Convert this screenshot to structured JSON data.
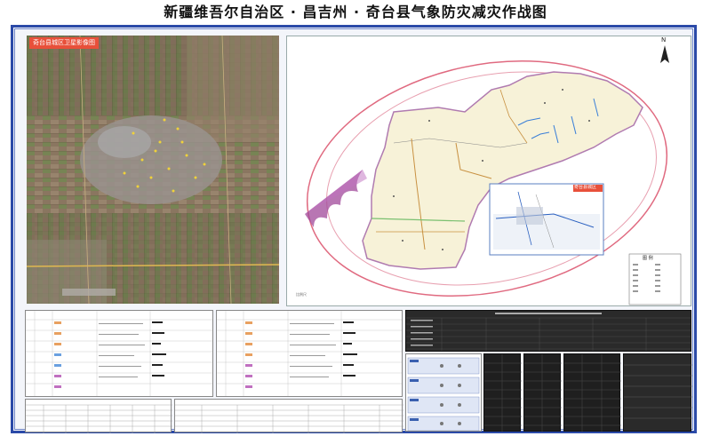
{
  "page": {
    "title": "新疆维吾尔自治区 · 昌吉州 · 奇台县气象防灾减灾作战图"
  },
  "satellite": {
    "label": "奇台县城区卫星影像图"
  },
  "map": {
    "north_label": "N",
    "inset_label": "奇台县城区",
    "legend_title": "图 例",
    "scale_text": "比例尺",
    "colors": {
      "county_fill": "#f7f2d8",
      "county_border": "#b07bb0",
      "ring_outer": "#e06a80",
      "ring_inner": "#e8a0b0",
      "fan": "#a0489a",
      "road": "#c89040",
      "river": "#3a7fd8",
      "highway": "#7ac070"
    }
  },
  "panels": {
    "bottom_left_title_1": "",
    "bottom_left_title_2": "",
    "dark_table_title": ""
  }
}
